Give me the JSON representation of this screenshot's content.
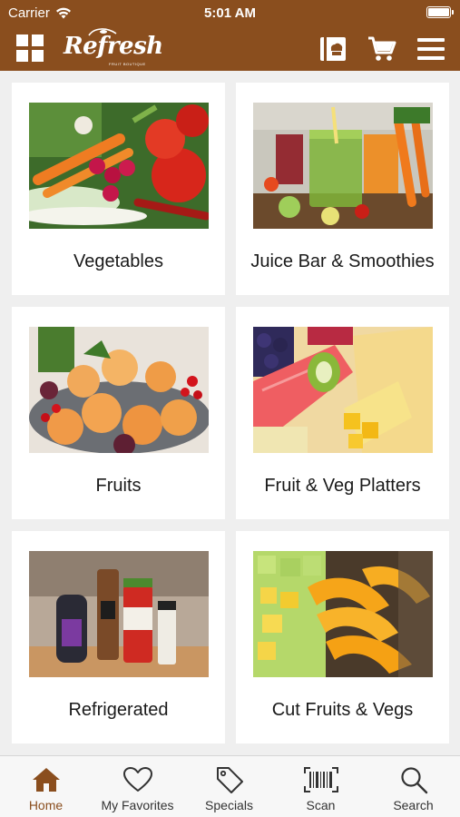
{
  "status_bar": {
    "carrier": "Carrier",
    "time": "5:01 AM"
  },
  "nav": {
    "logo_text": "Refresh",
    "logo_subtext": "FRUIT BOUTIQUE",
    "icons": [
      "grid-icon",
      "catalog-icon",
      "cart-icon",
      "menu-icon"
    ]
  },
  "categories": [
    {
      "label": "Vegetables",
      "icon": "vegetables-photo"
    },
    {
      "label": "Juice Bar & Smoothies",
      "icon": "juice-photo"
    },
    {
      "label": "Fruits",
      "icon": "fruits-photo"
    },
    {
      "label": "Fruit & Veg Platters",
      "icon": "platter-photo"
    },
    {
      "label": "Refrigerated",
      "icon": "refrigerated-photo"
    },
    {
      "label": "Cut Fruits & Vegs",
      "icon": "cut-fruit-photo"
    }
  ],
  "tabs": [
    {
      "label": "Home",
      "icon": "home-icon",
      "active": true
    },
    {
      "label": "My Favorites",
      "icon": "heart-icon",
      "active": false
    },
    {
      "label": "Specials",
      "icon": "tag-icon",
      "active": false
    },
    {
      "label": "Scan",
      "icon": "barcode-icon",
      "active": false
    },
    {
      "label": "Search",
      "icon": "search-icon",
      "active": false
    }
  ],
  "colors": {
    "brand": "#8a4e1e",
    "background": "#efefef",
    "card": "#ffffff",
    "active_tab": "#8a4e1e"
  }
}
